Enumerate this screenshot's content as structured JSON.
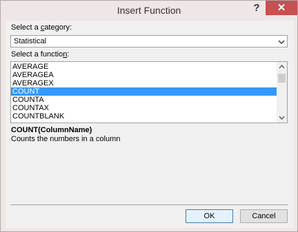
{
  "window": {
    "title": "Insert Function",
    "help_glyph": "?",
    "close_glyph": "✕"
  },
  "category": {
    "label_pre": "Select a ",
    "label_hot": "c",
    "label_post": "ategory:",
    "selected": "Statistical"
  },
  "function": {
    "label_pre": "Select a functio",
    "label_hot": "n",
    "label_post": ":",
    "items": [
      {
        "label": "AVERAGE",
        "selected": false
      },
      {
        "label": "AVERAGEA",
        "selected": false
      },
      {
        "label": "AVERAGEX",
        "selected": false
      },
      {
        "label": "COUNT",
        "selected": true
      },
      {
        "label": "COUNTA",
        "selected": false
      },
      {
        "label": "COUNTAX",
        "selected": false
      },
      {
        "label": "COUNTBLANK",
        "selected": false
      }
    ]
  },
  "description": {
    "signature": "COUNT(ColumnName)",
    "text": "Counts the numbers in a column"
  },
  "buttons": {
    "ok": "OK",
    "cancel": "Cancel"
  },
  "colors": {
    "selection": "#3399ff",
    "close_button": "#c75050"
  }
}
